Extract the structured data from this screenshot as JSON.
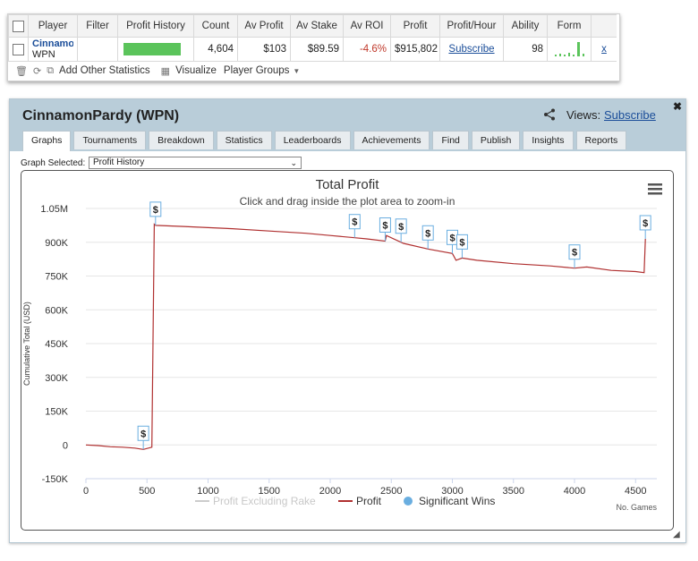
{
  "stats_table": {
    "headers": [
      "Player",
      "Filter",
      "Profit History",
      "Count",
      "Av Profit",
      "Av Stake",
      "Av ROI",
      "Profit",
      "Profit/Hour",
      "Ability",
      "Form"
    ],
    "row": {
      "player_name": "CinnamonPardy",
      "network": "WPN",
      "count": "4,604",
      "av_profit": "$103",
      "av_stake": "$89.59",
      "av_roi": "-4.6%",
      "profit": "$915,802",
      "profit_hour": "Subscribe",
      "ability": "98",
      "remove": "x"
    }
  },
  "toolbar": {
    "add_stats": "Add Other Statistics",
    "visualize": "Visualize",
    "player_groups": "Player Groups"
  },
  "panel": {
    "title": "CinnamonPardy (WPN)",
    "views_label": "Views:",
    "views_link": "Subscribe",
    "tabs": [
      "Graphs",
      "Tournaments",
      "Breakdown",
      "Statistics",
      "Leaderboards",
      "Achievements",
      "Find",
      "Publish",
      "Insights",
      "Reports"
    ],
    "graph_selected_label": "Graph Selected:",
    "graph_selected_value": "Profit History"
  },
  "colors": {
    "profit_line": "#b03030",
    "significant_wins": "#6aaee0",
    "header_bg": "#b9cdd9",
    "sparkline": "#5bc45b"
  },
  "chart_data": {
    "type": "line",
    "title": "Total Profit",
    "subtitle": "Click and drag inside the plot area to zoom-in",
    "xlabel": "No. Games",
    "ylabel": "Cumulative Total (USD)",
    "xlim": [
      0,
      4600
    ],
    "ylim": [
      -150000,
      1050000
    ],
    "x_ticks": [
      0,
      500,
      1000,
      1500,
      2000,
      2500,
      3000,
      3500,
      4000,
      4500
    ],
    "x_tick_labels": [
      "0",
      "500",
      "1000",
      "1500",
      "2000",
      "2500",
      "3000",
      "3500",
      "4000",
      "4500"
    ],
    "y_ticks": [
      -150000,
      0,
      150000,
      300000,
      450000,
      600000,
      750000,
      900000,
      1050000
    ],
    "y_tick_labels": [
      "-150K",
      "0",
      "150K",
      "300K",
      "450K",
      "600K",
      "750K",
      "900K",
      "1.05M"
    ],
    "legend": [
      "Profit Excluding Rake",
      "Profit",
      "Significant Wins"
    ],
    "series": [
      {
        "name": "Profit",
        "x": [
          0,
          100,
          200,
          300,
          400,
          470,
          540,
          560,
          570,
          800,
          1000,
          1200,
          1500,
          1800,
          2000,
          2200,
          2300,
          2450,
          2460,
          2600,
          2800,
          3000,
          3030,
          3080,
          3200,
          3500,
          3800,
          4000,
          4100,
          4300,
          4500,
          4570,
          4580
        ],
        "y": [
          0,
          -3000,
          -8000,
          -10000,
          -14000,
          -20000,
          -10000,
          980000,
          975000,
          970000,
          965000,
          960000,
          950000,
          940000,
          930000,
          920000,
          915000,
          905000,
          930000,
          895000,
          870000,
          850000,
          820000,
          830000,
          820000,
          805000,
          795000,
          785000,
          790000,
          775000,
          770000,
          765000,
          915000
        ]
      }
    ],
    "significant_wins_x": [
      470,
      570,
      2200,
      2450,
      2580,
      2800,
      3000,
      3080,
      4000,
      4580
    ]
  }
}
